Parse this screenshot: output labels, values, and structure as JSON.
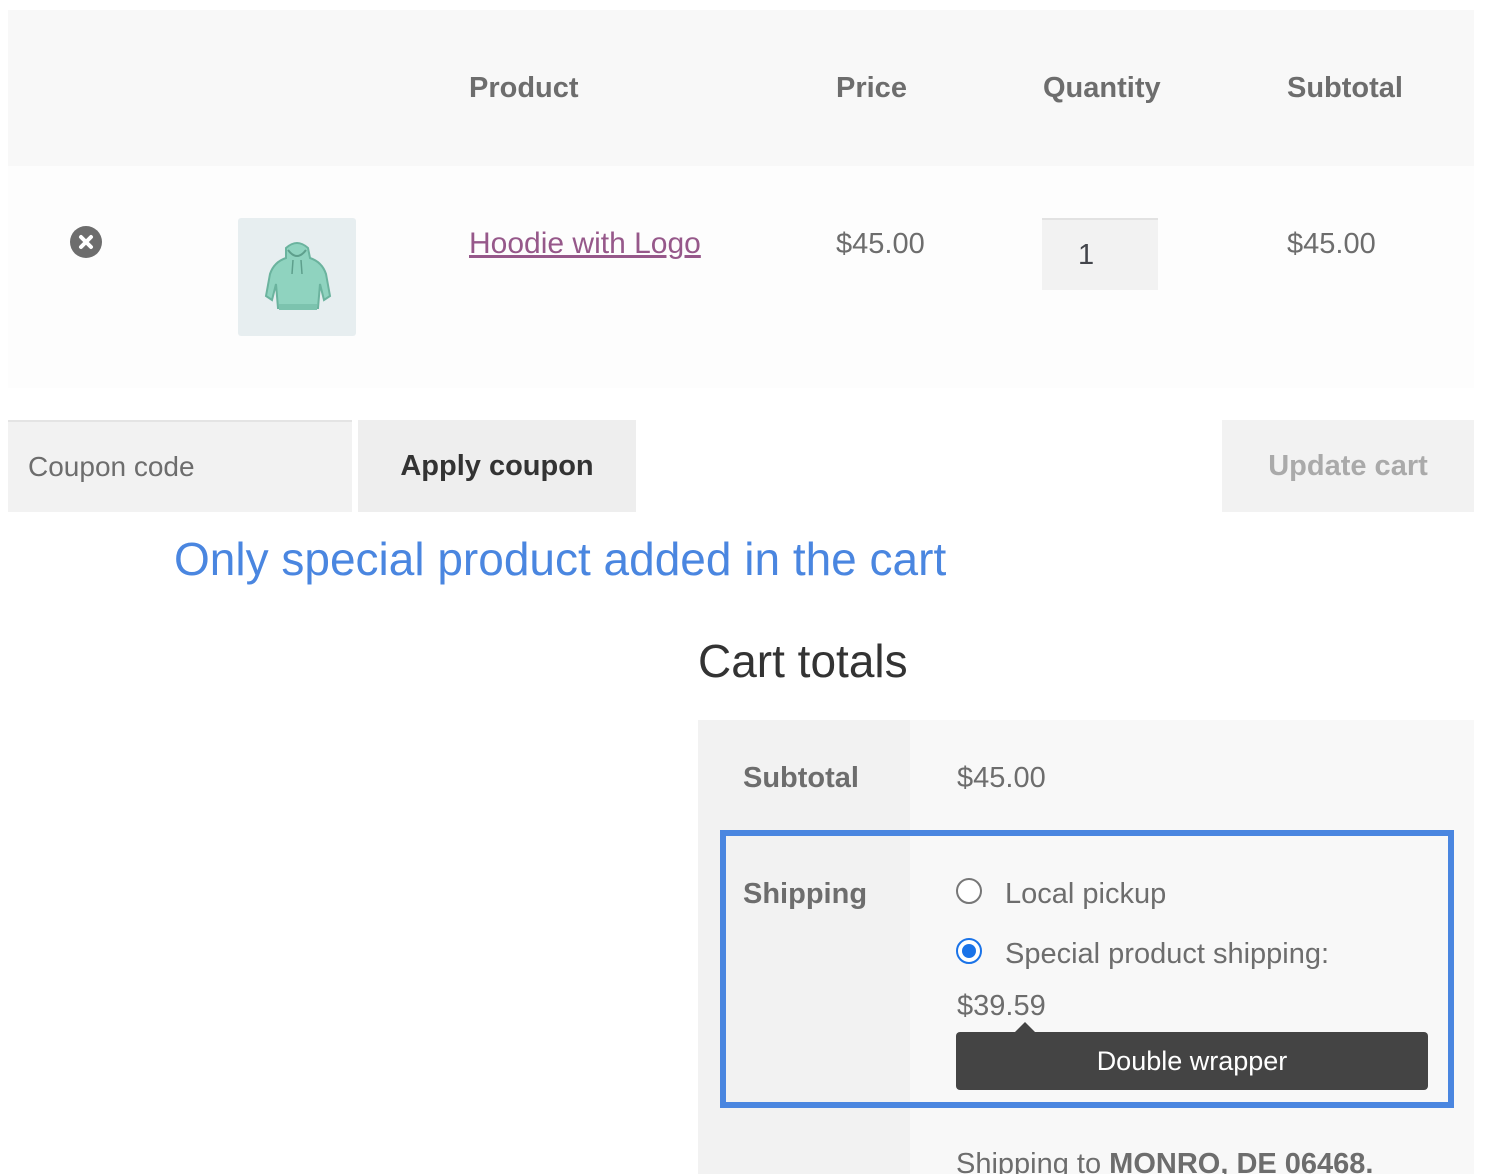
{
  "cart_table": {
    "headers": {
      "product": "Product",
      "price": "Price",
      "quantity": "Quantity",
      "subtotal": "Subtotal"
    },
    "row": {
      "remove_icon": "close-circle-icon",
      "thumbnail_icon": "hoodie-icon",
      "product_name": "Hoodie with Logo",
      "price": "$45.00",
      "quantity": "1",
      "subtotal": "$45.00"
    }
  },
  "coupon": {
    "placeholder": "Coupon code",
    "apply_label": "Apply coupon",
    "update_label": "Update cart"
  },
  "annotation": "Only special product added in the cart",
  "cart_totals": {
    "title": "Cart totals",
    "subtotal_label": "Subtotal",
    "subtotal_value": "$45.00",
    "shipping_label": "Shipping",
    "shipping_options": [
      {
        "label": "Local pickup",
        "selected": false
      },
      {
        "label": "Special product shipping:",
        "price": "$39.59",
        "selected": true
      }
    ],
    "tooltip": "Double wrapper",
    "shipping_to_prefix": "Shipping to ",
    "shipping_to_location": "MONRO, DE 06468."
  },
  "colors": {
    "link": "#96588a",
    "annotation": "#4a86e0",
    "radio_selected": "#1a73e8",
    "tooltip_bg": "#444444"
  }
}
